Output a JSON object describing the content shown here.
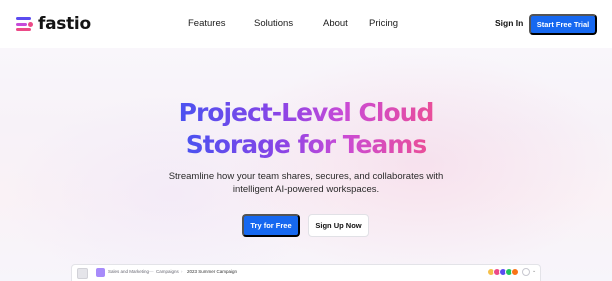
{
  "brand": {
    "name": "fastio"
  },
  "nav": {
    "links": [
      "Features",
      "Solutions",
      "About",
      "Pricing"
    ],
    "signin": "Sign In",
    "cta": "Start Free Trial"
  },
  "hero": {
    "title_line1": "Project-Level Cloud",
    "title_line2": "Storage for Teams",
    "subtitle_line1": "Streamline how your team shares, secures, and collaborates with",
    "subtitle_line2": "intelligent AI-powered workspaces.",
    "primary_cta": "Try for Free",
    "secondary_cta": "Sign Up Now"
  },
  "preview": {
    "workspace": "Sales and Marketing",
    "separator": "—",
    "folder": "Campaigns",
    "separator2": "›",
    "project": "2023 Summer Campaign",
    "chevron": "⌄",
    "avatar_colors": [
      "#f5c04a",
      "#ec4a87",
      "#5b4cf0",
      "#22c55e",
      "#f97316"
    ]
  },
  "colors": {
    "accent": "#1668f0",
    "gradient": [
      "#4b52f0",
      "#8a44e6",
      "#c94bd6",
      "#e94e9a"
    ]
  },
  "icons": {
    "logo": "fastio-stripes-icon",
    "thumbnail": "workspace-thumbnail-icon",
    "workspace": "workspace-icon",
    "more": "more-members-icon"
  }
}
